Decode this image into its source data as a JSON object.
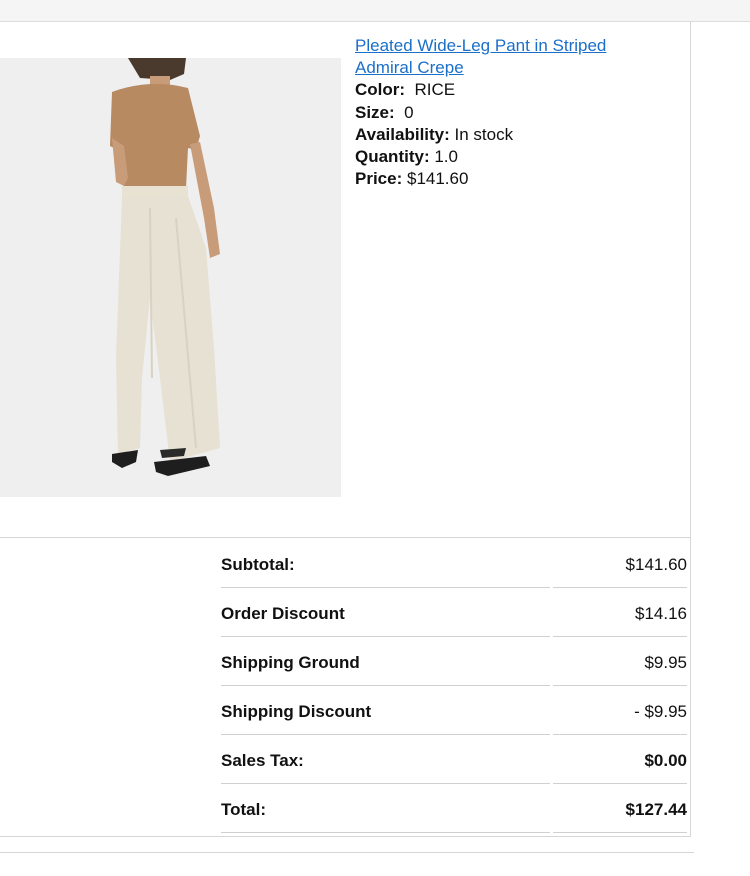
{
  "product": {
    "title": "Pleated Wide-Leg Pant in Striped Admiral Crepe",
    "image_alt": "Model wearing pleated wide-leg pant",
    "details": [
      {
        "label": "Color:",
        "value": "RICE"
      },
      {
        "label": "Size:",
        "value": "0"
      },
      {
        "label": "Availability:",
        "value": "In stock"
      },
      {
        "label": "Quantity:",
        "value": "1.0"
      },
      {
        "label": "Price:",
        "value": "$141.60"
      }
    ]
  },
  "summary": [
    {
      "label": "Subtotal:",
      "value": "$141.60"
    },
    {
      "label": "Order Discount",
      "value": "$14.16"
    },
    {
      "label": "Shipping Ground",
      "value": "$9.95"
    },
    {
      "label": "Shipping Discount",
      "value": "- $9.95"
    },
    {
      "label": "Sales Tax:",
      "value": "$0.00"
    },
    {
      "label": "Total:",
      "value": "$127.44"
    }
  ],
  "colors": {
    "link": "#1a6fc9",
    "border": "#d6d6d6",
    "image_bg": "#efefef"
  }
}
